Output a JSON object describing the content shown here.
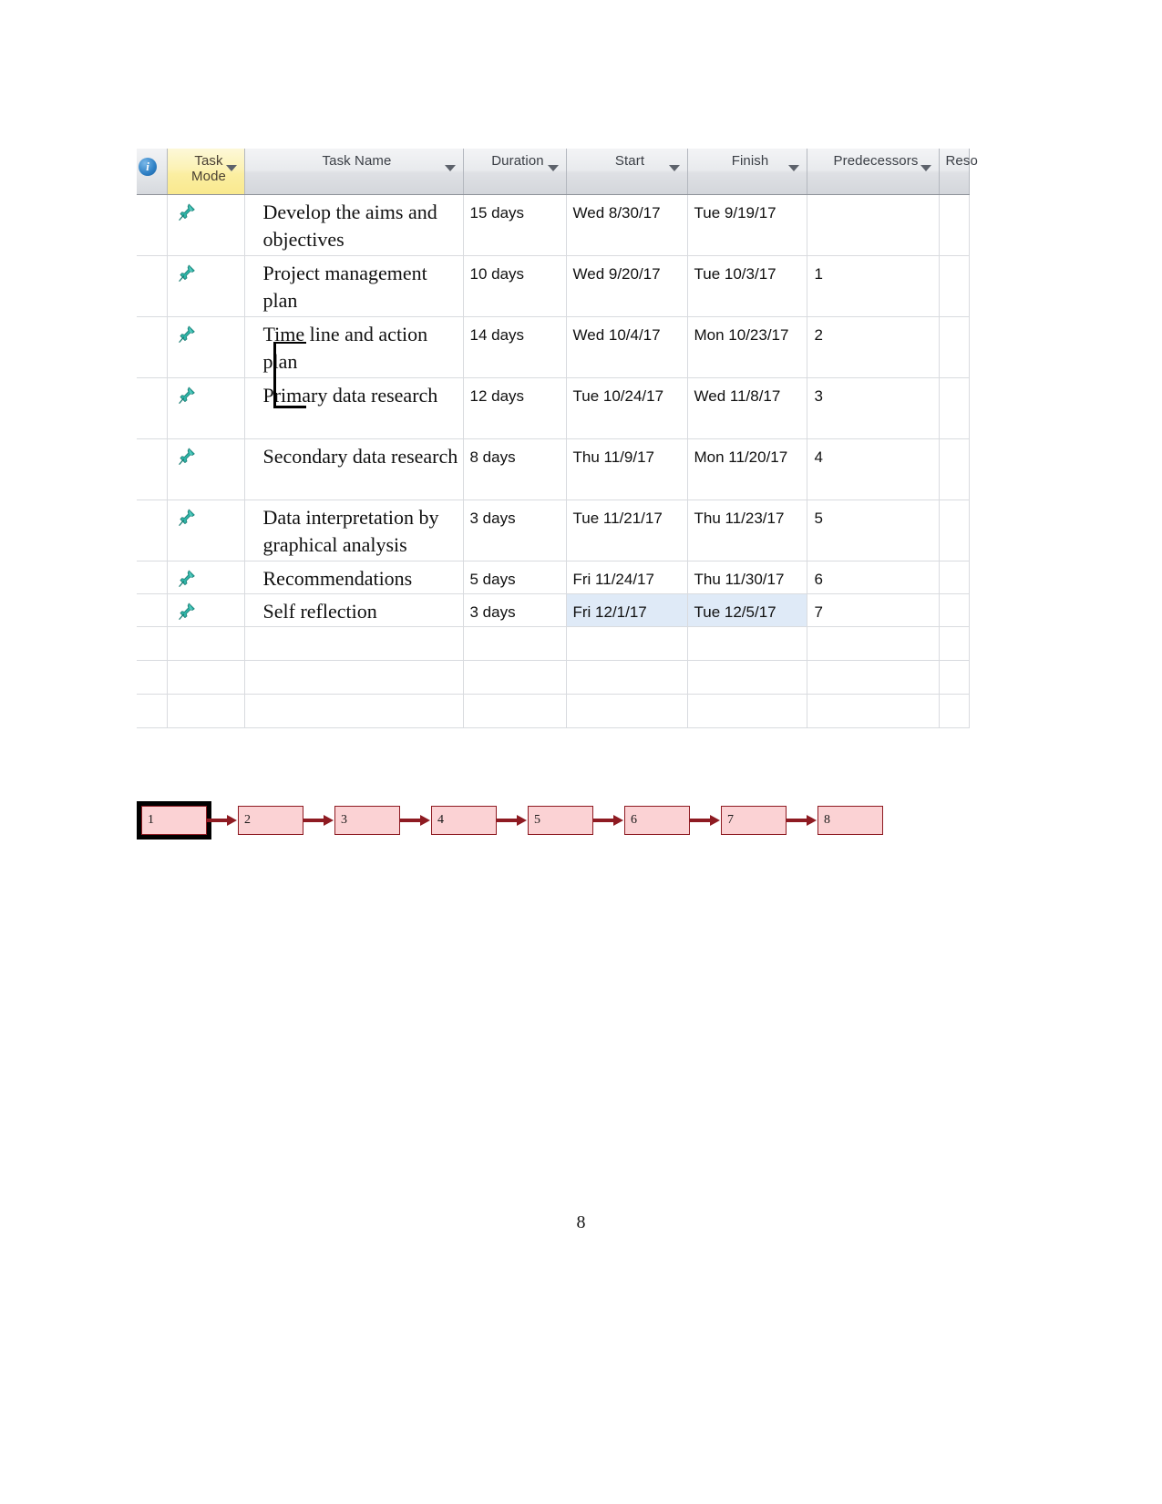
{
  "table": {
    "columns": [
      {
        "key": "info",
        "label": "",
        "icon": "info-icon",
        "has_filter": false
      },
      {
        "key": "mode",
        "label": "Task\nMode",
        "icon": "",
        "has_filter": true
      },
      {
        "key": "name",
        "label": "Task Name",
        "icon": "",
        "has_filter": true
      },
      {
        "key": "duration",
        "label": "Duration",
        "icon": "",
        "has_filter": true
      },
      {
        "key": "start",
        "label": "Start",
        "icon": "",
        "has_filter": true
      },
      {
        "key": "finish",
        "label": "Finish",
        "icon": "",
        "has_filter": true
      },
      {
        "key": "predecessors",
        "label": "Predecessors",
        "icon": "",
        "has_filter": true
      },
      {
        "key": "resources",
        "label": "Reso",
        "icon": "",
        "has_filter": false
      }
    ],
    "rows": [
      {
        "mode_icon": "pushpin-icon",
        "name": "Develop the aims and objectives",
        "duration": "15 days",
        "start": "Wed 8/30/17",
        "finish": "Tue 9/19/17",
        "predecessors": "",
        "resources": "",
        "selected": false,
        "active": true
      },
      {
        "mode_icon": "pushpin-icon",
        "name": "Project management plan",
        "duration": "10 days",
        "start": "Wed 9/20/17",
        "finish": "Tue 10/3/17",
        "predecessors": "1",
        "resources": "",
        "selected": false,
        "active": false
      },
      {
        "mode_icon": "pushpin-icon",
        "name": "Time line and action plan",
        "duration": "14 days",
        "start": "Wed 10/4/17",
        "finish": "Mon 10/23/17",
        "predecessors": "2",
        "resources": "",
        "selected": false,
        "active": false
      },
      {
        "mode_icon": "pushpin-icon",
        "name": "Primary data research",
        "duration": "12 days",
        "start": "Tue 10/24/17",
        "finish": "Wed 11/8/17",
        "predecessors": "3",
        "resources": "",
        "selected": false,
        "active": false
      },
      {
        "mode_icon": "pushpin-icon",
        "name": "Secondary data research",
        "duration": "8 days",
        "start": "Thu 11/9/17",
        "finish": "Mon 11/20/17",
        "predecessors": "4",
        "resources": "",
        "selected": false,
        "active": false
      },
      {
        "mode_icon": "pushpin-icon",
        "name": "Data interpretation by graphical analysis",
        "duration": "3 days",
        "start": "Tue 11/21/17",
        "finish": "Thu 11/23/17",
        "predecessors": "5",
        "resources": "",
        "selected": false,
        "active": false
      },
      {
        "mode_icon": "pushpin-icon",
        "name": "Recommendations",
        "duration": "5 days",
        "start": "Fri 11/24/17",
        "finish": "Thu 11/30/17",
        "predecessors": "6",
        "resources": "",
        "selected": false,
        "active": false,
        "short": true
      },
      {
        "mode_icon": "pushpin-icon",
        "name": "Self reflection",
        "duration": "3 days",
        "start": "Fri 12/1/17",
        "finish": "Tue 12/5/17",
        "predecessors": "7",
        "resources": "",
        "selected": true,
        "active": false,
        "short": true
      }
    ],
    "empty_rows": 3
  },
  "network_diagram": {
    "nodes": [
      {
        "label": "1",
        "selected": true
      },
      {
        "label": "2",
        "selected": false
      },
      {
        "label": "3",
        "selected": false
      },
      {
        "label": "4",
        "selected": false
      },
      {
        "label": "5",
        "selected": false
      },
      {
        "label": "6",
        "selected": false
      },
      {
        "label": "7",
        "selected": false
      },
      {
        "label": "8",
        "selected": false
      }
    ],
    "node_fill": "#fbd2d4",
    "node_border": "#8e1b22",
    "arrow_color": "#8e1b22"
  },
  "footer": {
    "page_number": "8"
  }
}
